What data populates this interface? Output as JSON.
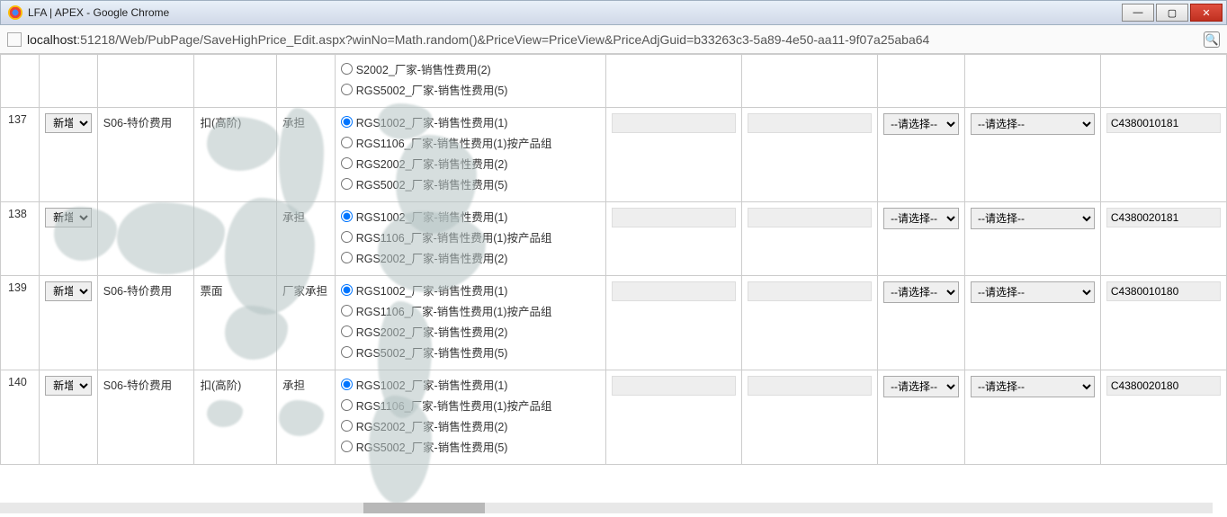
{
  "window": {
    "title": "LFA | APEX - Google Chrome"
  },
  "address": {
    "host": "localhost",
    "rest": ":51218/Web/PubPage/SaveHighPrice_Edit.aspx?winNo=Math.random()&PriceView=PriceView&PriceAdjGuid=b33263c3-5a89-4e50-aa11-9f07a25aba64"
  },
  "common": {
    "action_label": "新增",
    "select_placeholder": "--请选择--"
  },
  "top_partial": [
    "S2002_厂家-销售性费用(2)",
    "RGS5002_厂家-销售性费用(5)"
  ],
  "rows": [
    {
      "idx": "137",
      "type": "S06-特价费用",
      "desc": "扣(高阶)",
      "bear": "承担",
      "options": [
        "RGS1002_厂家-销售性费用(1)",
        "RGS1106_厂家-销售性费用(1)按产品组",
        "RGS2002_厂家-销售性费用(2)",
        "RGS5002_厂家-销售性费用(5)"
      ],
      "selected": 0,
      "code": "C4380010181"
    },
    {
      "idx": "138",
      "type": "",
      "desc": "",
      "bear": "承担",
      "options": [
        "RGS1002_厂家-销售性费用(1)",
        "RGS1106_厂家-销售性费用(1)按产品组",
        "RGS2002_厂家-销售性费用(2)"
      ],
      "selected": 0,
      "code": "C4380020181"
    },
    {
      "idx": "139",
      "type": "S06-特价费用",
      "desc": "票面",
      "bear": "厂家承担",
      "options": [
        "RGS1002_厂家-销售性费用(1)",
        "RGS1106_厂家-销售性费用(1)按产品组",
        "RGS2002_厂家-销售性费用(2)",
        "RGS5002_厂家-销售性费用(5)"
      ],
      "selected": 0,
      "code": "C4380010180"
    },
    {
      "idx": "140",
      "type": "S06-特价费用",
      "desc": "扣(高阶)",
      "bear": "承担",
      "options": [
        "RGS1002_厂家-销售性费用(1)",
        "RGS1106_厂家-销售性费用(1)按产品组",
        "RGS2002_厂家-销售性费用(2)",
        "RGS5002_厂家-销售性费用(5)"
      ],
      "selected": 0,
      "code": "C4380020180"
    }
  ]
}
